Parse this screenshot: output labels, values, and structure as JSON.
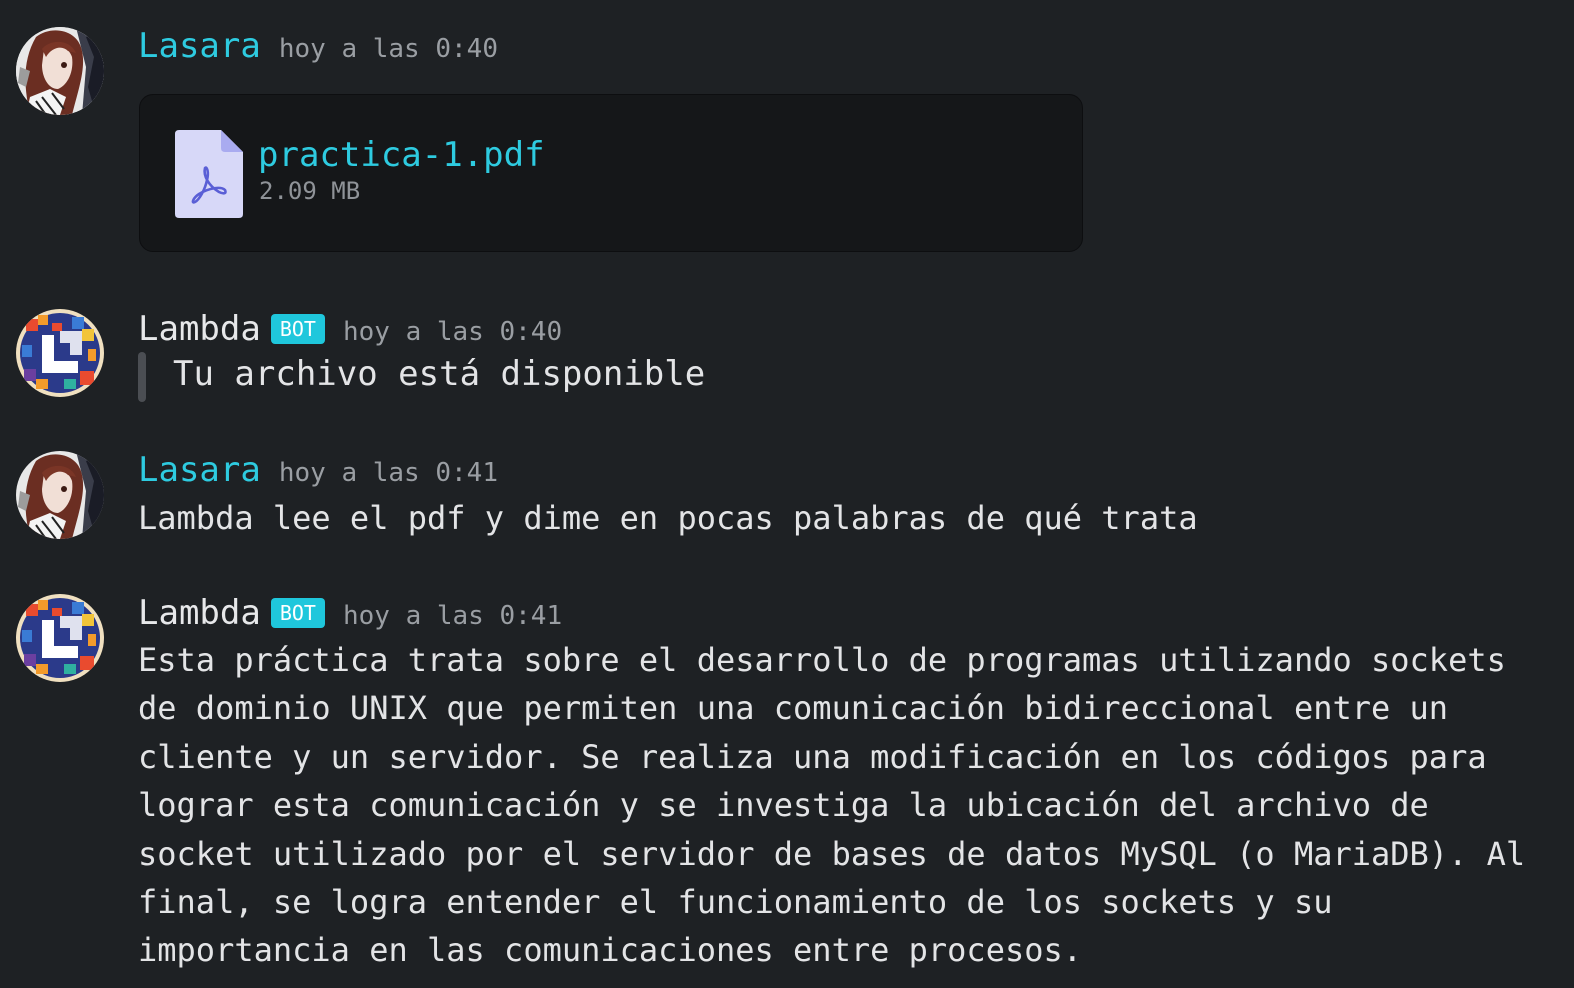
{
  "messages": [
    {
      "author": "Lasara",
      "timestamp": "hoy a las 0:40",
      "attachment": {
        "file_name": "practica-1.pdf",
        "file_size": "2.09 MB",
        "icon": "pdf-file-icon"
      }
    },
    {
      "author": "Lambda",
      "bot_tag": "BOT",
      "timestamp": "hoy a las 0:40",
      "quote": "Tu archivo está disponible"
    },
    {
      "author": "Lasara",
      "timestamp": "hoy a las 0:41",
      "text": "Lambda lee el pdf y dime en pocas palabras de qué trata"
    },
    {
      "author": "Lambda",
      "bot_tag": "BOT",
      "timestamp": "hoy a las 0:41",
      "text": "Esta práctica trata sobre el desarrollo de programas utilizando sockets de dominio UNIX que permiten una comunicación bidireccional entre un cliente y un servidor. Se realiza una modificación en los códigos para lograr esta comunicación y se investiga la ubicación del archivo de socket utilizado por el servidor de bases de datos MySQL (o MariaDB). Al final, se logra entender el funcionamiento de los sockets y su importancia en las comunicaciones entre procesos."
    }
  ],
  "colors": {
    "background": "#1e2124",
    "user_name": "#2ecbe0",
    "bot_tag": "#1fc7dc",
    "timestamp": "#9a9ea3",
    "attachment_bg": "#151719",
    "pdf_icon": "#d7d8f8"
  }
}
